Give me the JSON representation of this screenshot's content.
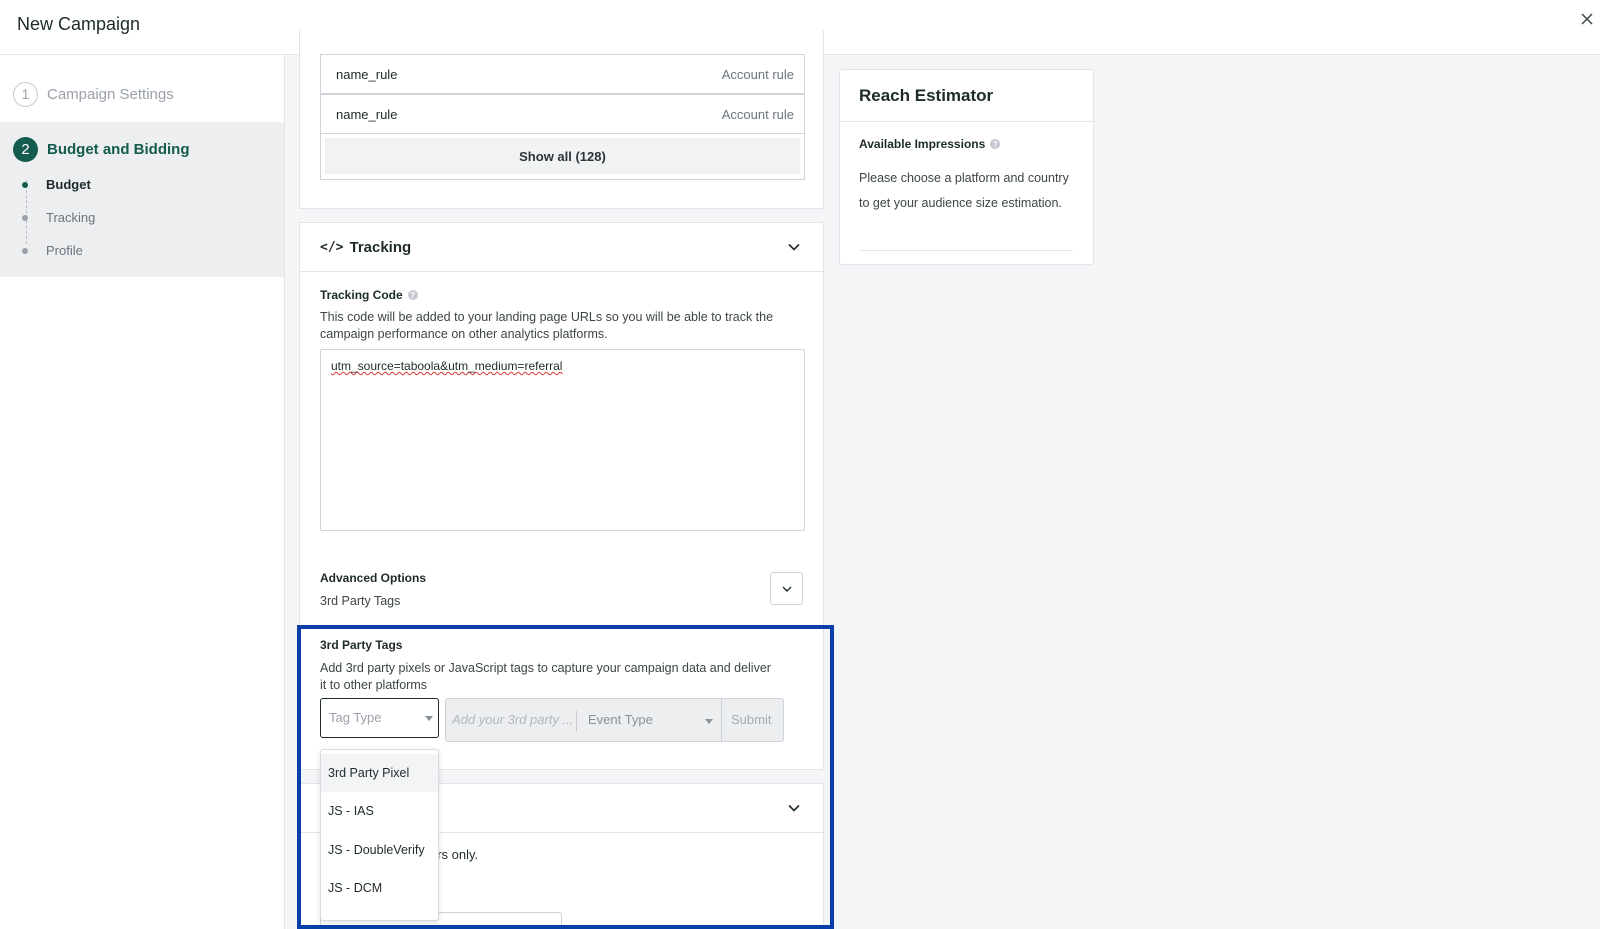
{
  "header": {
    "title": "New Campaign"
  },
  "sidebar": {
    "steps": [
      {
        "number": "1",
        "label": "Campaign Settings"
      },
      {
        "number": "2",
        "label": "Budget and Bidding"
      }
    ],
    "substeps": [
      "Budget",
      "Tracking",
      "Profile"
    ]
  },
  "rules": {
    "rows": [
      {
        "name": "name_rule",
        "type": "Account rule"
      },
      {
        "name": "name_rule",
        "type": "Account rule"
      }
    ],
    "show_all": "Show all (128)"
  },
  "tracking": {
    "icon_text": "</>",
    "title": "Tracking",
    "code_label": "Tracking Code",
    "code_desc": "This code will be added to your landing page URLs so you will be able to track the campaign performance on other analytics platforms.",
    "code_value": "utm_source=taboola&utm_medium=referral",
    "advanced_label": "Advanced Options",
    "advanced_sub": "3rd Party Tags",
    "tags_label": "3rd Party Tags",
    "tags_desc": "Add 3rd party pixels or JavaScript tags to capture your campaign data and deliver it to other platforms",
    "tag_type_placeholder": "Tag Type",
    "tag_input_placeholder": "Add your 3rd party ...",
    "event_type_placeholder": "Event Type",
    "submit_label": "Submit"
  },
  "tag_type_options": [
    "3rd Party Pixel",
    "JS - IAS",
    "JS - DoubleVerify",
    "JS - DCM"
  ],
  "lower_section": {
    "partial_text": "ers only."
  },
  "reach": {
    "title": "Reach Estimator",
    "impressions_label": "Available Impressions",
    "impressions_text": "Please choose a platform and country to get your audience size estimation."
  },
  "colors": {
    "brand": "#135c4e",
    "highlight": "#0a3ea8"
  }
}
